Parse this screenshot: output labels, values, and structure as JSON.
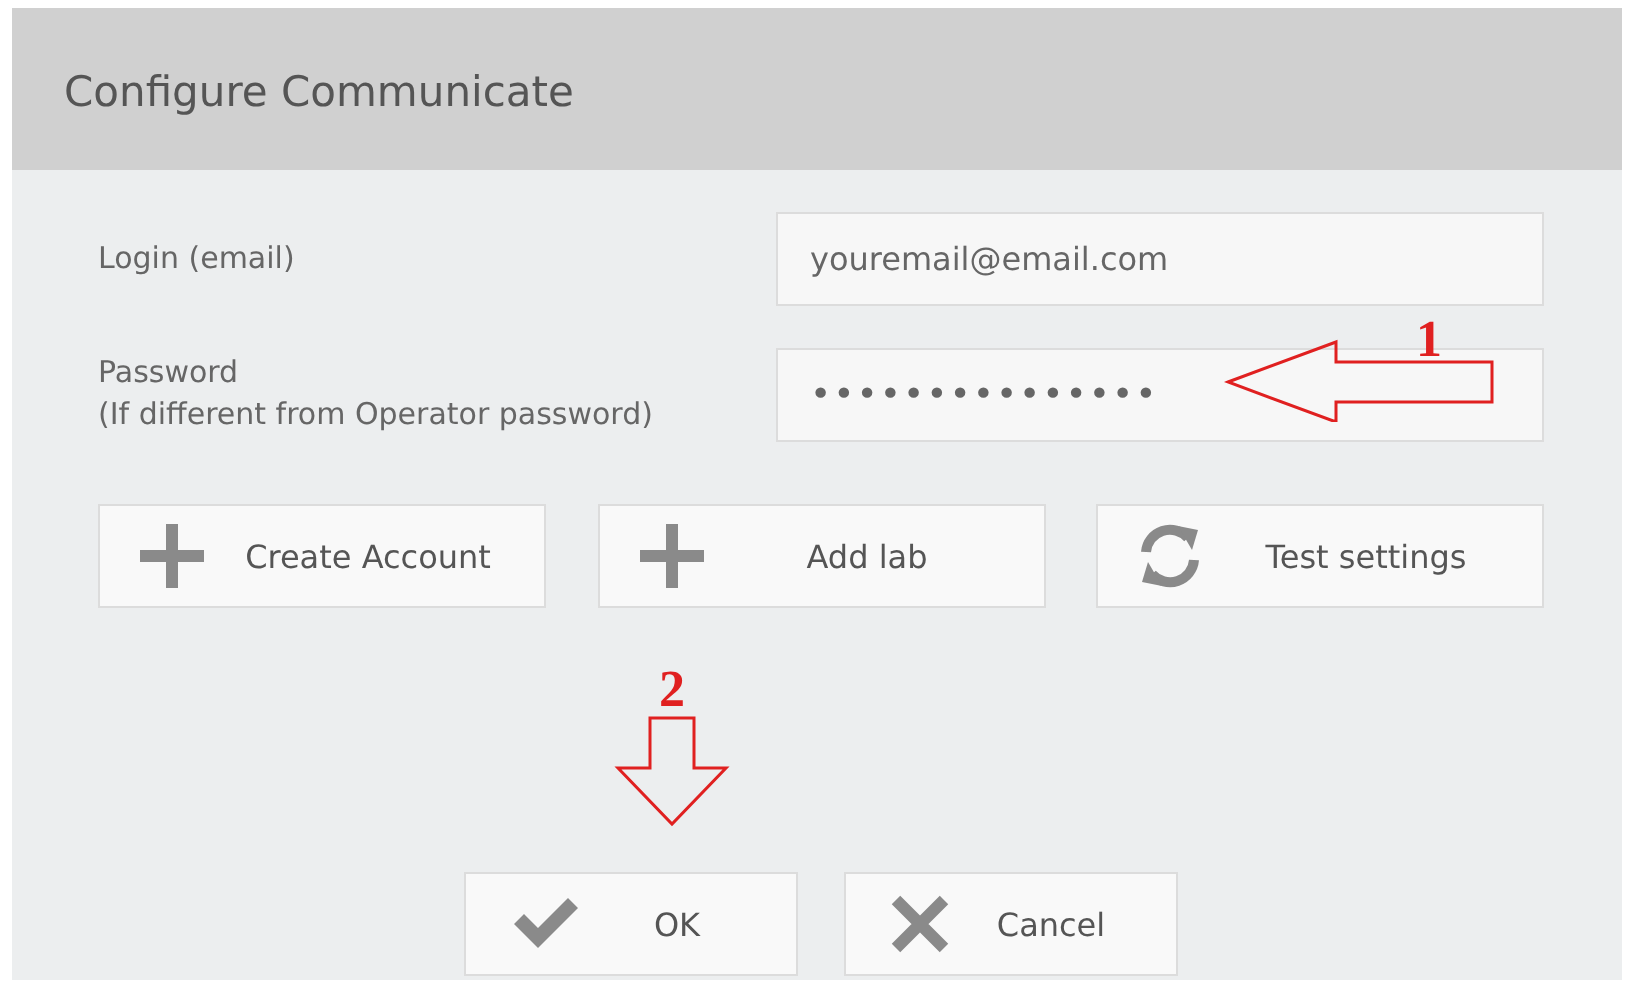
{
  "dialog": {
    "title": "Configure Communicate"
  },
  "fields": [
    {
      "label": "Login (email)",
      "value": "youremail@email.com",
      "kind": "text"
    },
    {
      "label": "Password",
      "hint": "(If different from Operator password)",
      "value": "•••••••••••••••",
      "kind": "password"
    }
  ],
  "actions": [
    {
      "label": "Create Account",
      "kind": "plus"
    },
    {
      "label": "Add lab",
      "kind": "plus"
    },
    {
      "label": "Test settings",
      "kind": "refresh"
    }
  ],
  "buttons": [
    {
      "label": "OK",
      "kind": "check"
    },
    {
      "label": "Cancel",
      "kind": "cross"
    }
  ],
  "annotations": [
    {
      "number": "1"
    },
    {
      "number": "2"
    }
  ]
}
